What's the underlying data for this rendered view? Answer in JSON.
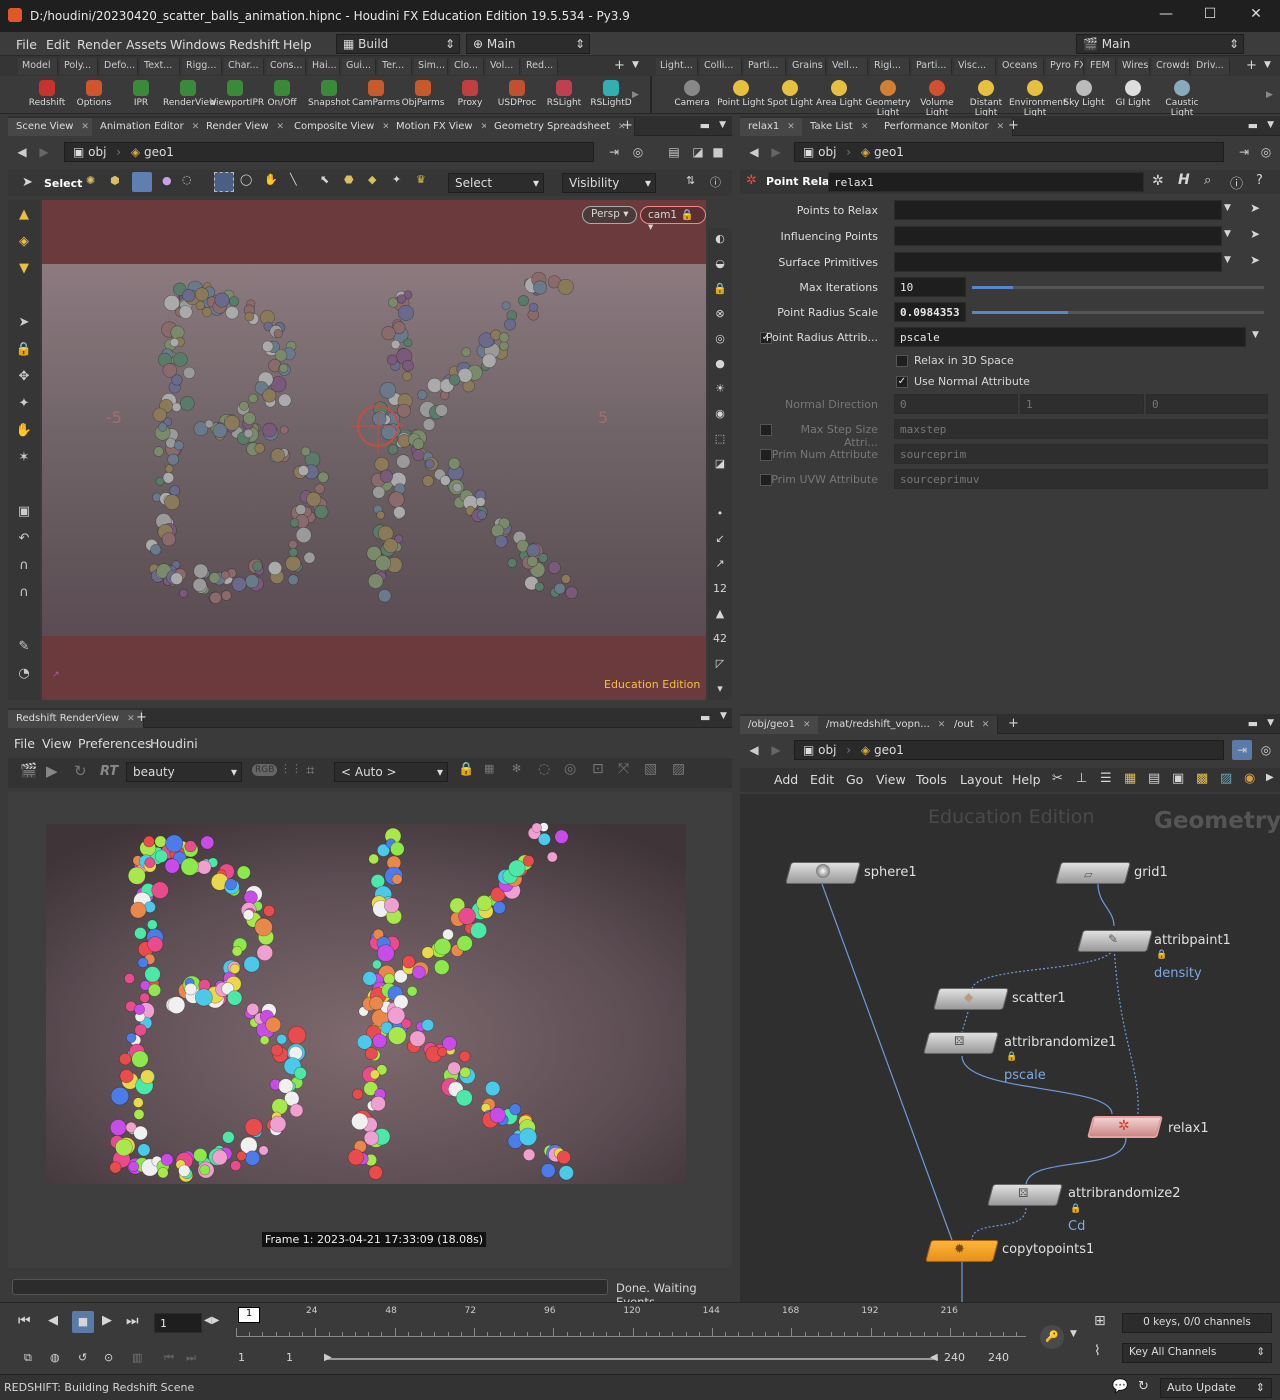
{
  "window": {
    "title": "D:/houdini/20230420_scatter_balls_animation.hipnc - Houdini FX Education Edition 19.5.534 - Py3.9",
    "min": "—",
    "max": "☐",
    "close": "✕"
  },
  "menubar": {
    "items": [
      "File",
      "Edit",
      "Render",
      "Assets",
      "Windows",
      "Redshift",
      "Help"
    ],
    "desktop": "Build",
    "context": "Main",
    "right_context": "Main"
  },
  "shelf_tabs_left": [
    "Model",
    "Poly...",
    "Defo...",
    "Text...",
    "Rigg...",
    "Char...",
    "Cons...",
    "Hai...",
    "Gui...",
    "Ter...",
    "Sim...",
    "Clo...",
    "Vol...",
    "Red..."
  ],
  "shelf_tabs_right": [
    "Light...",
    "Colli...",
    "Parti...",
    "Grains",
    "Vell...",
    "Rigi...",
    "Parti...",
    "Visc...",
    "Oceans",
    "Pyro FX",
    "FEM",
    "Wires",
    "Crowds",
    "Driv..."
  ],
  "shelf_tools_left": [
    {
      "label": "Redshift",
      "color": "#c8342c"
    },
    {
      "label": "Options",
      "color": "#d0542c"
    },
    {
      "label": "IPR",
      "color": "#3a8a3a"
    },
    {
      "label": "RenderView",
      "color": "#3a8a3a"
    },
    {
      "label": "ViewportIPR",
      "color": "#3a8a3a"
    },
    {
      "label": "On/Off",
      "color": "#3a8a3a"
    },
    {
      "label": "Snapshot",
      "color": "#3a8a3a"
    },
    {
      "label": "CamParms",
      "color": "#c85a2a"
    },
    {
      "label": "ObjParms",
      "color": "#c85a2a"
    },
    {
      "label": "Proxy",
      "color": "#c04040"
    },
    {
      "label": "USDProc",
      "color": "#c05030"
    },
    {
      "label": "RSLight",
      "color": "#c04050"
    },
    {
      "label": "RSLightD",
      "color": "#30b0b0"
    }
  ],
  "shelf_tools_right": [
    {
      "label": "Camera",
      "color": "#888"
    },
    {
      "label": "Point Light",
      "color": "#e8c040"
    },
    {
      "label": "Spot Light",
      "color": "#e8c040"
    },
    {
      "label": "Area Light",
      "color": "#e8c040"
    },
    {
      "label": "Geometry Light",
      "color": "#d08030"
    },
    {
      "label": "Volume Light",
      "color": "#d05030"
    },
    {
      "label": "Distant Light",
      "color": "#e8c040"
    },
    {
      "label": "Environment Light",
      "color": "#e8c040"
    },
    {
      "label": "Sky Light",
      "color": "#bbb"
    },
    {
      "label": "GI Light",
      "color": "#ddd"
    },
    {
      "label": "Caustic Light",
      "color": "#8ab"
    }
  ],
  "viewer": {
    "tabs": [
      "Scene View",
      "Animation Editor",
      "Render View",
      "Composite View",
      "Motion FX View",
      "Geometry Spreadsheet"
    ],
    "path": {
      "root": "obj",
      "node": "geo1"
    },
    "select_label": "Select",
    "select_mode": "Select",
    "visibility": "Visibility",
    "persp": "Persp ▾",
    "cam": "cam1 🔒▾",
    "watermark": "Education Edition",
    "axis_left": "-5",
    "axis_right": "5"
  },
  "params": {
    "tabs": [
      "relax1",
      "Take List",
      "Performance Monitor"
    ],
    "path": {
      "root": "obj",
      "node": "geo1"
    },
    "node_type": "Point Relax",
    "node_name": "relax1",
    "rows": [
      {
        "label": "Points to Relax",
        "value": ""
      },
      {
        "label": "Influencing Points",
        "value": ""
      },
      {
        "label": "Surface Primitives",
        "value": ""
      },
      {
        "label": "Max Iterations",
        "value": "10",
        "slider": 0.14
      },
      {
        "label": "Point Radius Scale",
        "value": "0.0984353",
        "slider": 0.33
      },
      {
        "label": "Point Radius Attrib...",
        "value": "pscale"
      }
    ],
    "relax3d": "Relax in 3D Space",
    "use_normal": "Use Normal Attribute",
    "normal_dir": {
      "label": "Normal Direction",
      "x": "0",
      "y": "1",
      "z": "0"
    },
    "max_step": {
      "label": "Max Step Size Attri...",
      "value": "maxstep"
    },
    "prim_num": {
      "label": "Prim Num Attribute",
      "value": "sourceprim"
    },
    "prim_uvw": {
      "label": "Prim UVW Attribute",
      "value": "sourceprimuv"
    }
  },
  "renderview": {
    "tab": "Redshift RenderView",
    "menu": [
      "File",
      "View",
      "Preferences",
      "Houdini"
    ],
    "aov": "beauty",
    "camera": "< Auto >",
    "rt": "RT",
    "frame_info": "Frame 1:  2023-04-21  17:33:09  (18.08s)",
    "status": "Done. Waiting Events"
  },
  "network": {
    "tabs": [
      "/obj/geo1",
      "/mat/redshift_vopn...",
      "/out"
    ],
    "path": {
      "root": "obj",
      "node": "geo1"
    },
    "menu": [
      "Add",
      "Edit",
      "Go",
      "View",
      "Tools",
      "Layout",
      "Help"
    ],
    "watermark": "Education Edition",
    "context": "Geometry",
    "nodes": {
      "sphere1": "sphere1",
      "grid1": "grid1",
      "attribpaint1": "attribpaint1",
      "density": "density",
      "scatter1": "scatter1",
      "attribrandomize1": "attribrandomize1",
      "pscale": "pscale",
      "relax1": "relax1",
      "attribrandomize2": "attribrandomize2",
      "Cd": "Cd",
      "copytopoints1": "copytopoints1"
    }
  },
  "timeline": {
    "frame": "1",
    "ticks": [
      "24",
      "48",
      "72",
      "96",
      "120",
      "144",
      "168",
      "192",
      "216"
    ],
    "current_marker": "1",
    "start": "1",
    "range_start": "1",
    "range_end": "240",
    "end": "240",
    "keys": "0 keys, 0/0 channels",
    "key_all": "Key All Channels"
  },
  "statusbar": {
    "message": "REDSHIFT: Building Redshift Scene",
    "auto_update": "Auto Update"
  },
  "colors": {
    "accent_orange": "#f6a018",
    "selected_node": "#e8a0a0",
    "wire": "#6f9ad8"
  }
}
